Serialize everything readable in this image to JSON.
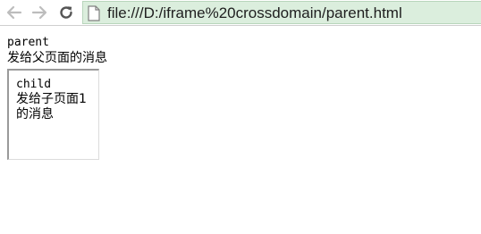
{
  "browser": {
    "url": "file:///D:/iframe%20crossdomain/parent.html",
    "icons": {
      "back": "arrow-left-icon",
      "forward": "arrow-right-icon",
      "reload": "reload-icon",
      "page": "page-icon"
    },
    "address_bg": "#dbeedd"
  },
  "parent": {
    "title": "parent",
    "message": "发给父页面的消息"
  },
  "child": {
    "title": "child",
    "message": "发给子页面1的消息"
  }
}
